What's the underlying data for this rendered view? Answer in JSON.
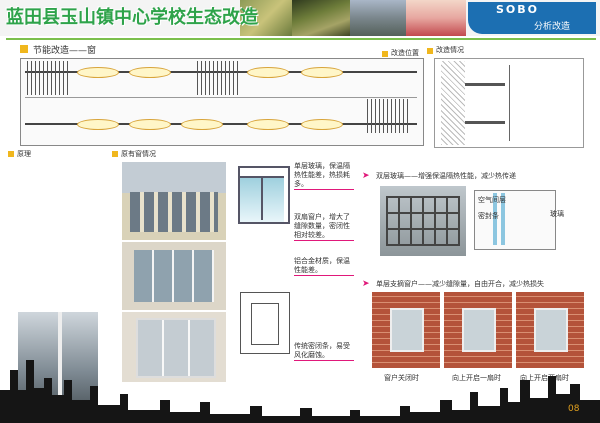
{
  "header": {
    "title": "蓝田县玉山镇中心学校生态改造",
    "brand_label": "分析改造",
    "brand_logo_text": "SOBO"
  },
  "section1": {
    "title": "节能改造——窗",
    "tag_position": "改造位置",
    "tag_situation": "改造情况"
  },
  "left_column": {
    "title": "原理",
    "text": ""
  },
  "middle_column": {
    "title": "原有窗情况"
  },
  "window_notes": [
    "单层玻璃，保温隔热性能差，热损耗多。",
    "双扇窗户，增大了缝隙数量，密闭性相对较差。",
    "铝合金材质，保温性能差。",
    "传统密闭条，易受风化磨蚀。"
  ],
  "right_upper": {
    "caption": "双层玻璃——增强保温隔热性能，减少热传递",
    "labels": [
      "空气间层",
      "密封条",
      "玻璃"
    ]
  },
  "right_lower": {
    "caption": "单层支摘窗户——减少缝隙量，自由开合，减少热损失",
    "photo_labels": [
      "窗户关闭时",
      "向上开启一扇时",
      "向上开启两扇时"
    ]
  },
  "page_number": "08",
  "colors": {
    "title_green": "#2ea34a",
    "brand_blue": "#1c6fb2",
    "accent_pink": "#e0187a",
    "accent_yellow": "#f0b71e"
  }
}
